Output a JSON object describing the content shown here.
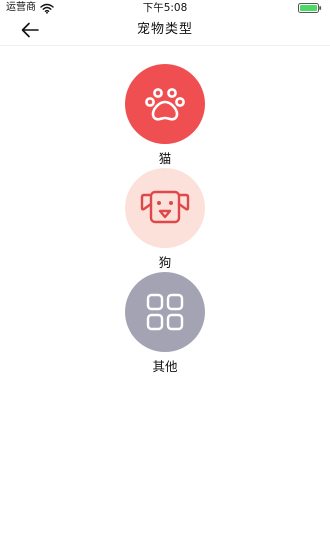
{
  "status_bar": {
    "carrier": "运营商",
    "time": "下午5:08",
    "icons": [
      "wifi-icon",
      "battery-icon"
    ],
    "battery_color": "#4cd964"
  },
  "nav": {
    "title": "宠物类型",
    "back_icon": "arrow-left-icon"
  },
  "pet_types": [
    {
      "label": "猫",
      "icon": "paw-icon",
      "bg_color": "#ef4f50",
      "icon_color": "#ffffff"
    },
    {
      "label": "狗",
      "icon": "dog-face-icon",
      "bg_color": "#fbe1d9",
      "icon_color": "#e0474a"
    },
    {
      "label": "其他",
      "icon": "grid-icon",
      "bg_color": "#a3a3b4",
      "icon_color": "#ffffff"
    }
  ]
}
